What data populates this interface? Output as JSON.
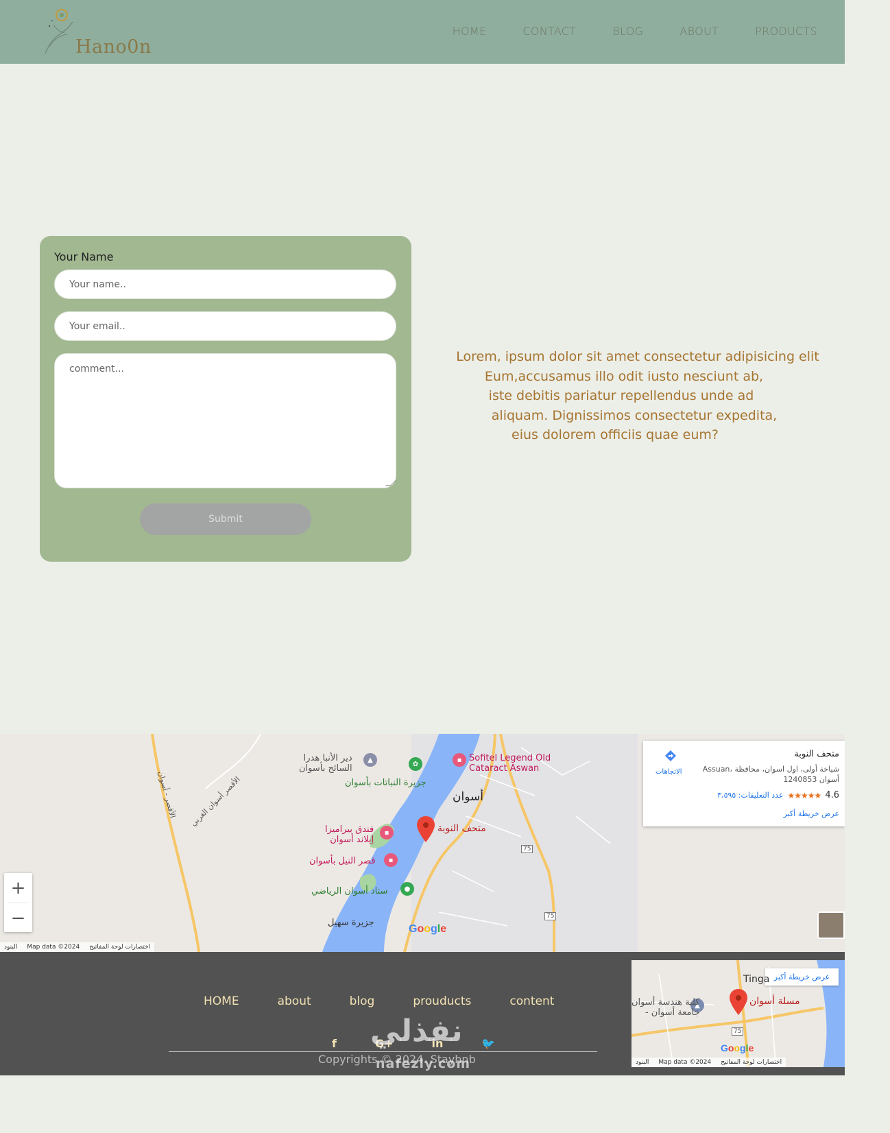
{
  "header": {
    "logo_text": "Hano0n",
    "nav": [
      "HOME",
      "CONTACT",
      "BLOG",
      "ABOUT",
      "PRODUCTS"
    ]
  },
  "form": {
    "label": "Your Name",
    "name_placeholder": "Your name..",
    "email_placeholder": "Your email..",
    "comment_placeholder": "comment...",
    "submit_label": "Submit"
  },
  "lorem": [
    "Lorem, ipsum dolor sit amet consectetur adipisicing elit",
    "Eum,accusamus illo odit iusto nesciunt ab,",
    "iste debitis pariatur repellendus unde ad",
    "aliquam. Dignissimos consectetur expedita,",
    "eius dolorem officiis quae eum?"
  ],
  "map": {
    "labels": {
      "sofitel": "Sofitel Legend Old\nCataract Aswan",
      "deir": "دير الأنبا هدرا\nالسائح بأسوان",
      "botanical": "جزيرة النباتات بأسوان",
      "aswan": "أسوان",
      "museum": "متحف النوبة",
      "pyramisa": "فندق بيراميزا\nإيلاند أسوان",
      "nile_palace": "قصر النيل بأسوان",
      "stadium": "ستاد أسوان الرياضي",
      "sohail": "جزيرة سهيل",
      "west_road": "الأقصر أسوان الغربي",
      "luxor_road": "الأقصر - أسوان",
      "road75": "75",
      "road75b": "75"
    },
    "info": {
      "title": "متحف النوبة",
      "address": "Assuan، شياخة أولى، اول اسوان، محافظة أسوان 1240853",
      "rating": "4.6",
      "stars": "★★★★★",
      "reviews": "عدد التعليقات: ٣،٥٩٥",
      "directions": "الاتجاهات",
      "larger_map": "عرض خريطة أكبر"
    },
    "zoom_in": "+",
    "zoom_out": "−",
    "attribution": [
      "اختصارات لوحة المفاتيح",
      "Map data ©2024",
      "البنود"
    ],
    "google": "Google"
  },
  "footer": {
    "nav": [
      "HOME",
      "about",
      "blog",
      "prouducts",
      "content"
    ],
    "social": [
      "f",
      "G+",
      "in",
      "🐦"
    ],
    "copyright": "Copyrights © 2024. Stayhnb",
    "mini_map": {
      "larger_map": "عرض خريطة أكبر",
      "obelisk": "مسلة أسوان",
      "college": "كلية هندسة أسوان\n- جامعة أسوان",
      "tinga": "Tinga",
      "road": "75",
      "attribution": [
        "اختصارات لوحة المفاتيح",
        "Map data ©2024",
        "البنود"
      ],
      "google": "Google"
    }
  },
  "watermark": {
    "main": "نفذلي",
    "sub": "nafezly.com"
  },
  "colors": {
    "header_bg": "#8fae9e",
    "page_bg": "#eceee8",
    "form_bg": "#a1b891",
    "lorem_text": "#a67530",
    "footer_bg": "#525252",
    "footer_text": "#f2e2b4"
  }
}
